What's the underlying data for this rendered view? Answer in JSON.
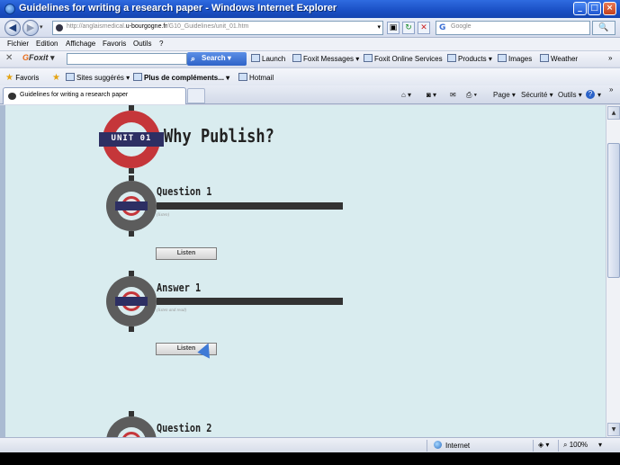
{
  "window": {
    "title": "Guidelines for writing a research paper - Windows Internet Explorer",
    "minimize": "_",
    "maximize": "□",
    "close": "×"
  },
  "address": {
    "back": "◀",
    "forward": "▶",
    "dropdown": "▾",
    "url_prefix": "http://anglaismedical.",
    "url_domain": "u-bourgogne.fr",
    "url_path": "/G10_Guidelines/unit_01.htm",
    "refresh": "↻",
    "stop": "✕",
    "search_placeholder": "Google",
    "search_go": "🔍"
  },
  "menu": [
    "Fichier",
    "Edition",
    "Affichage",
    "Favoris",
    "Outils",
    "?"
  ],
  "foxit": {
    "close": "✕",
    "logo_mark": "G",
    "logo_text": "Foxit",
    "dropdown": "▾",
    "search_label": "Search",
    "search_dropdown": "▾",
    "items": [
      "Launch",
      "Foxit Messages",
      "Foxit Online Services",
      "Products",
      "Images",
      "Weather"
    ],
    "item_dropdowns": [
      "",
      "▾",
      "",
      "▾",
      "",
      ""
    ],
    "more": "»"
  },
  "favorites": {
    "label": "Favoris",
    "sites_suggested": "Sites suggérés",
    "more_addons": "Plus de compléments...",
    "hotmail": "Hotmail",
    "dropdown": "▾"
  },
  "tab": {
    "title": "Guidelines for writing a research paper"
  },
  "commands": {
    "page": "Page",
    "securite": "Sécurité",
    "outils": "Outils",
    "help": "?",
    "dropdown": "▾",
    "more": "»"
  },
  "content": {
    "unit_label": "UNIT 01",
    "page_title": "Why Publish?",
    "sections": [
      {
        "title": "Question 1",
        "subtitle": "(listen)",
        "button": "Listen"
      },
      {
        "title": "Answer 1",
        "subtitle": "(listen and read)",
        "button": "Listen"
      },
      {
        "title": "Question 2",
        "subtitle": "",
        "button": ""
      }
    ]
  },
  "scrollbar": {
    "up": "▲",
    "down": "▼"
  },
  "status": {
    "zone": "Internet",
    "zoom": "100%",
    "dropdown": "▾"
  },
  "colors": {
    "accent_red": "#c5363a",
    "bar_navy": "#2d2f63",
    "content_bg": "#d9ecef"
  }
}
